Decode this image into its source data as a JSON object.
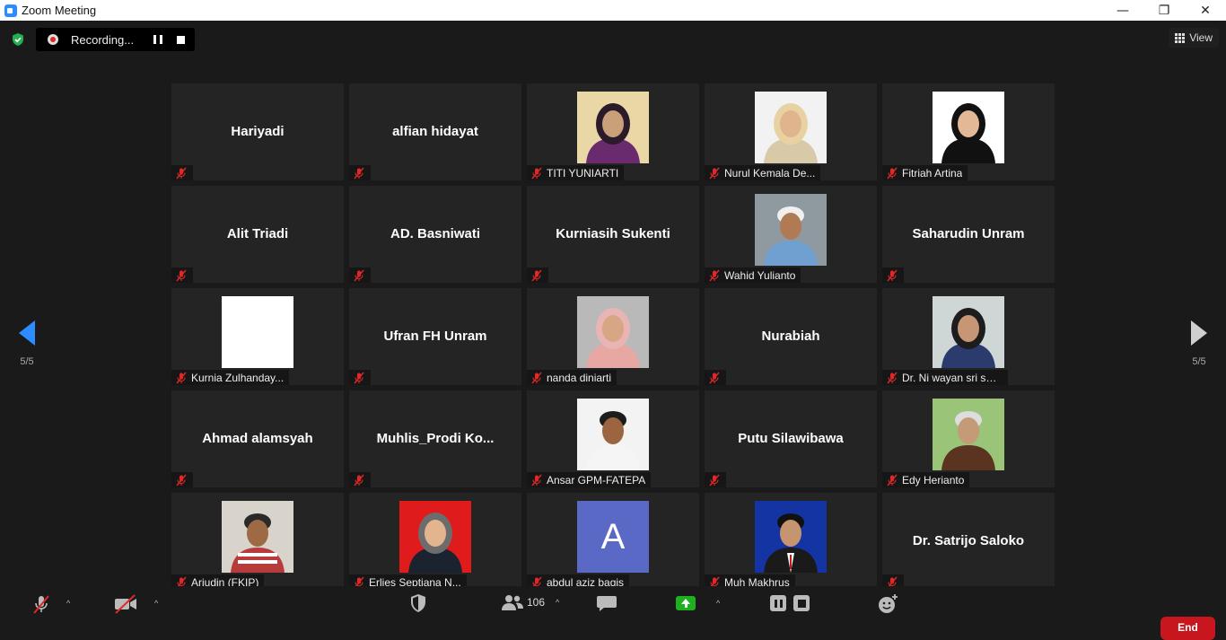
{
  "window": {
    "title": "Zoom Meeting",
    "minimize_glyph": "—",
    "restore_glyph": "❐",
    "close_glyph": "✕"
  },
  "recording": {
    "label": "Recording..."
  },
  "view": {
    "label": "View"
  },
  "pagination": {
    "left_label": "5/5",
    "right_label": "5/5"
  },
  "participants": [
    {
      "name": "Hariyadi",
      "label": "",
      "photo": false
    },
    {
      "name": "alfian hidayat",
      "label": "",
      "photo": false
    },
    {
      "name": "",
      "label": "TITI YUNIARTI",
      "photo": true,
      "photo_kind": "woman-purple"
    },
    {
      "name": "",
      "label": "Nurul Kemala De...",
      "photo": true,
      "photo_kind": "woman-beige"
    },
    {
      "name": "",
      "label": "Fitriah Artina",
      "photo": true,
      "photo_kind": "woman-black"
    },
    {
      "name": "Alit Triadi",
      "label": "",
      "photo": false
    },
    {
      "name": "AD. Basniwati",
      "label": "",
      "photo": false
    },
    {
      "name": "Kurniasih Sukenti",
      "label": "",
      "photo": false
    },
    {
      "name": "",
      "label": "Wahid Yulianto",
      "photo": true,
      "photo_kind": "man-window"
    },
    {
      "name": "Saharudin Unram",
      "label": "",
      "photo": false
    },
    {
      "name": "",
      "label": "Kurnia Zulhanday...",
      "photo": true,
      "photo_kind": "blank-white"
    },
    {
      "name": "Ufran FH Unram",
      "label": "",
      "photo": false
    },
    {
      "name": "",
      "label": "nanda diniarti",
      "photo": true,
      "photo_kind": "woman-pink"
    },
    {
      "name": "Nurabiah",
      "label": "",
      "photo": false
    },
    {
      "name": "",
      "label": "Dr. Ni wayan sri suli...",
      "photo": true,
      "photo_kind": "woman-office"
    },
    {
      "name": "Ahmad alamsyah",
      "label": "",
      "photo": false
    },
    {
      "name": "Muhlis_Prodi  Ko...",
      "label": "",
      "photo": false
    },
    {
      "name": "",
      "label": "Ansar GPM-FATEPA",
      "photo": true,
      "photo_kind": "man-white"
    },
    {
      "name": "Putu Silawibawa",
      "label": "",
      "photo": false
    },
    {
      "name": "",
      "label": "Edy Herianto",
      "photo": true,
      "photo_kind": "man-banner"
    },
    {
      "name": "",
      "label": "Arjudin (FKIP)",
      "photo": true,
      "photo_kind": "man-striped"
    },
    {
      "name": "",
      "label": "Erlies Septiana N...",
      "photo": true,
      "photo_kind": "woman-red"
    },
    {
      "name": "",
      "label": "abdul aziz bagis",
      "photo": true,
      "photo_kind": "avatar-letter",
      "avatar_letter": "A"
    },
    {
      "name": "",
      "label": "Muh Makhrus",
      "photo": true,
      "photo_kind": "man-blue"
    },
    {
      "name": "Dr. Satrijo Saloko",
      "label": "",
      "photo": false
    }
  ],
  "toolbar": {
    "participants_count": "106",
    "end_label": "End",
    "caret": "^"
  },
  "colors": {
    "accent": "#2d8cff",
    "muted_mic": "#e02828",
    "share_green": "#1fb01f",
    "end_red": "#c8161e"
  }
}
